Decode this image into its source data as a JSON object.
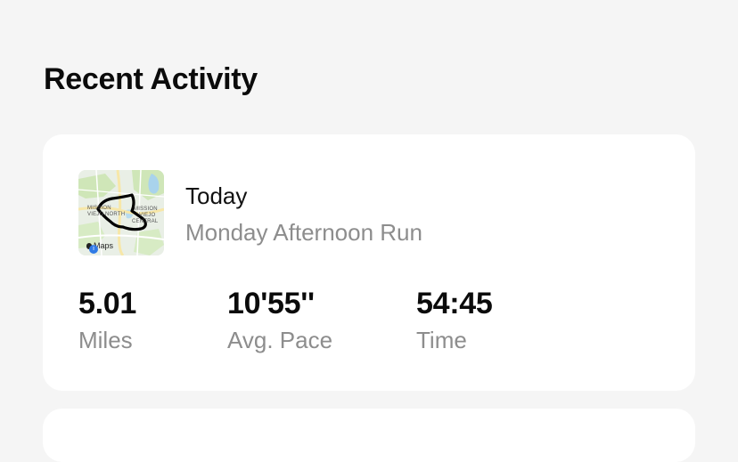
{
  "section": {
    "title": "Recent Activity"
  },
  "activity": {
    "date": "Today",
    "name": "Monday Afternoon Run",
    "map": {
      "places": [
        "MISSION",
        "VIEJO",
        "NORTH",
        "MISSION",
        "VIEJO",
        "CENTRAL"
      ],
      "attribution": "Maps"
    },
    "stats": [
      {
        "value": "5.01",
        "label": "Miles"
      },
      {
        "value": "10'55''",
        "label": "Avg. Pace"
      },
      {
        "value": "54:45",
        "label": "Time"
      }
    ]
  },
  "colors": {
    "background": "#f5f5f5",
    "card": "#ffffff",
    "primary_text": "#111111",
    "secondary_text": "#8d8d8d",
    "route": "#000000",
    "map_land": "#e9efe6",
    "map_park": "#cfe6b8",
    "map_water": "#a9d3ec",
    "map_road": "#f7e7a8"
  }
}
